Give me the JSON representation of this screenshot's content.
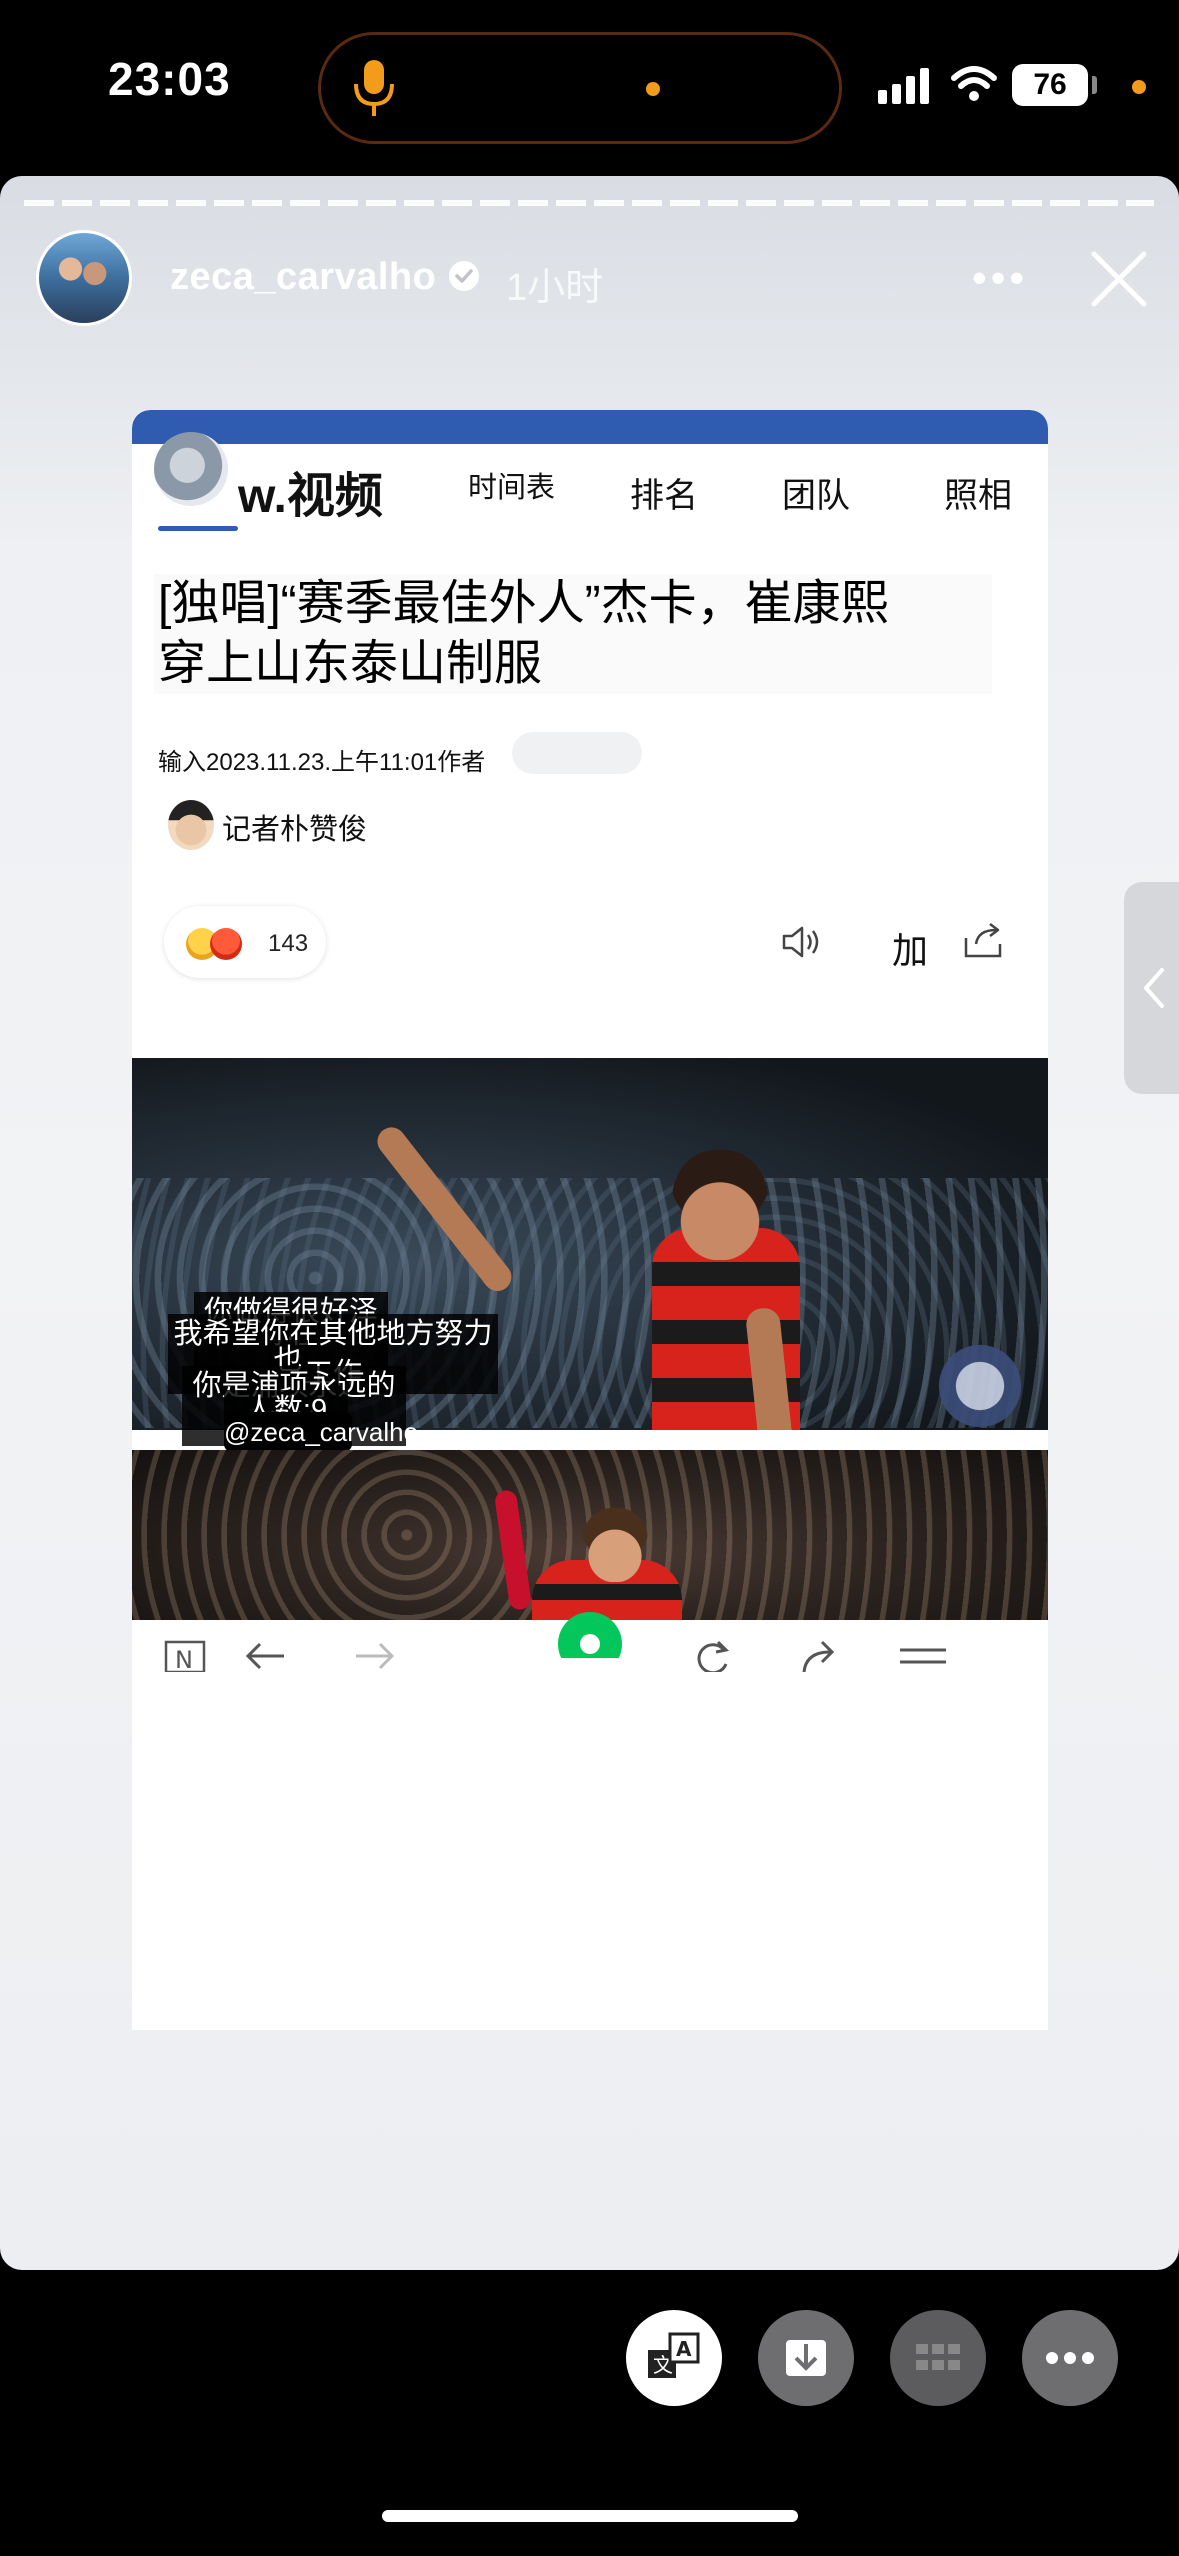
{
  "status_bar": {
    "time": "23:03",
    "battery": "76"
  },
  "story": {
    "username": "zeca_carvalho",
    "time_ago": "1小时",
    "more_label": "•••"
  },
  "article": {
    "nav_logo": "w.视频",
    "nav_items": [
      "时间表",
      "排名",
      "团队",
      "照相"
    ],
    "title_line1": "[独唱]“赛季最佳外人”杰卡，崔康熙",
    "title_line2": "穿上山东泰山制服",
    "meta": "输入2023.11.23.上午11:01作者",
    "reporter": "记者朴赞俊",
    "reaction_count": "143",
    "font_button": "加"
  },
  "captions": [
    "你做得很好泽卡",
    "我希望你在其他地方努力工作",
    "也",
    "你是浦项永远的前锋",
    "人数:9",
    "@zeca_carvalho"
  ],
  "icons": {
    "mic": "microphone-icon",
    "verified": "verified-badge-icon",
    "close": "close-icon",
    "translate": "translate-icon",
    "save": "download-icon",
    "grid": "grid-icon",
    "more": "more-horizontal-icon"
  },
  "colors": {
    "accent_orange": "#f39b1a",
    "naver_blue": "#2f5bb0",
    "jersey_red": "#d8231c"
  }
}
